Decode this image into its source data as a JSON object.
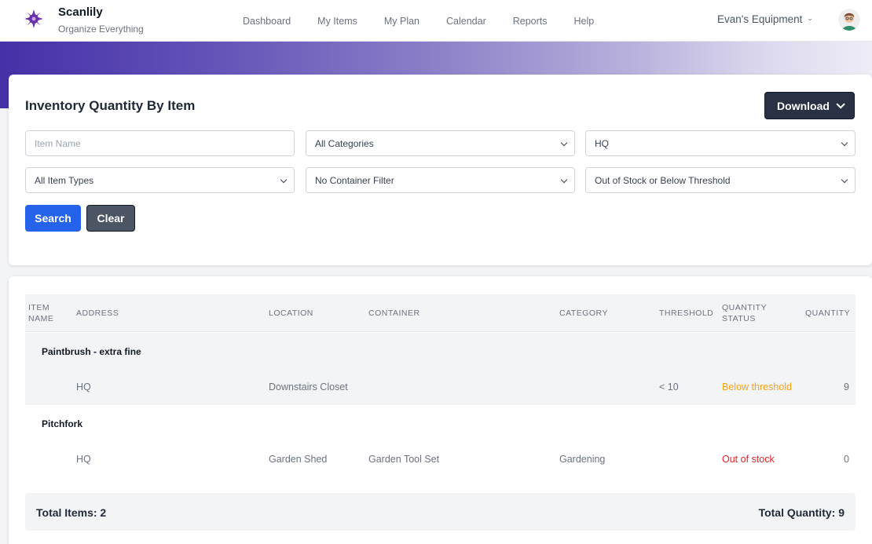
{
  "app": {
    "name": "Scanlily",
    "tagline": "Organize Everything"
  },
  "nav": {
    "items": [
      "Dashboard",
      "My Items",
      "My Plan",
      "Calendar",
      "Reports",
      "Help"
    ]
  },
  "account": {
    "label": "Evan's Equipment"
  },
  "colors": {
    "accent": "#2563eb",
    "brand": "#4630a8",
    "below_threshold": "#f5a316",
    "out_of_stock": "#e0242b"
  },
  "report": {
    "title": "Inventory Quantity By Item",
    "download_label": "Download"
  },
  "filters": {
    "item_name_placeholder": "Item Name",
    "item_name_value": "",
    "category": "All Categories",
    "address": "HQ",
    "item_type": "All Item Types",
    "container": "No Container Filter",
    "stock_status": "Out of Stock or Below Threshold",
    "search_label": "Search",
    "clear_label": "Clear"
  },
  "table": {
    "columns": [
      "Item Name",
      "Address",
      "Location",
      "Container",
      "Category",
      "Threshold",
      "Quantity Status",
      "Quantity"
    ],
    "groups": [
      {
        "name": "Paintbrush - extra fine",
        "rows": [
          {
            "address": "HQ",
            "location": "Downstairs Closet",
            "container": "",
            "category": "",
            "threshold": "< 10",
            "status": "Below threshold",
            "quantity": "9"
          }
        ]
      },
      {
        "name": "Pitchfork",
        "rows": [
          {
            "address": "HQ",
            "location": "Garden Shed",
            "container": "Garden Tool Set",
            "category": "Gardening",
            "threshold": "",
            "status": "Out of stock",
            "quantity": "0"
          }
        ]
      }
    ]
  },
  "totals": {
    "items_label": "Total Items: 2",
    "quantity_label": "Total Quantity: 9"
  }
}
